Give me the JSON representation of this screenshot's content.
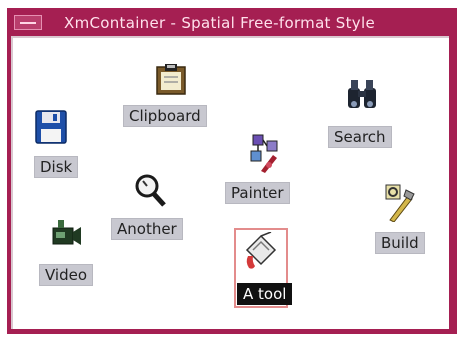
{
  "window": {
    "title": "XmContainer - Spatial Free-format Style"
  },
  "icons": [
    {
      "id": "clipboard",
      "label": "Clipboard",
      "icon": "clipboard-icon"
    },
    {
      "id": "disk",
      "label": "Disk",
      "icon": "floppy-disk-icon"
    },
    {
      "id": "search",
      "label": "Search",
      "icon": "binoculars-icon"
    },
    {
      "id": "painter",
      "label": "Painter",
      "icon": "painter-icon"
    },
    {
      "id": "another",
      "label": "Another",
      "icon": "magnifier-icon"
    },
    {
      "id": "build",
      "label": "Build",
      "icon": "build-tool-icon"
    },
    {
      "id": "video",
      "label": "Video",
      "icon": "video-camera-icon"
    },
    {
      "id": "atool",
      "label": "A tool",
      "icon": "paint-bucket-icon",
      "selected": true
    }
  ],
  "colors": {
    "titlebar": "#a51f52",
    "label_bg": "#c8c8d0",
    "selected_label_bg": "#111111",
    "selection_border": "#e38c8c"
  }
}
